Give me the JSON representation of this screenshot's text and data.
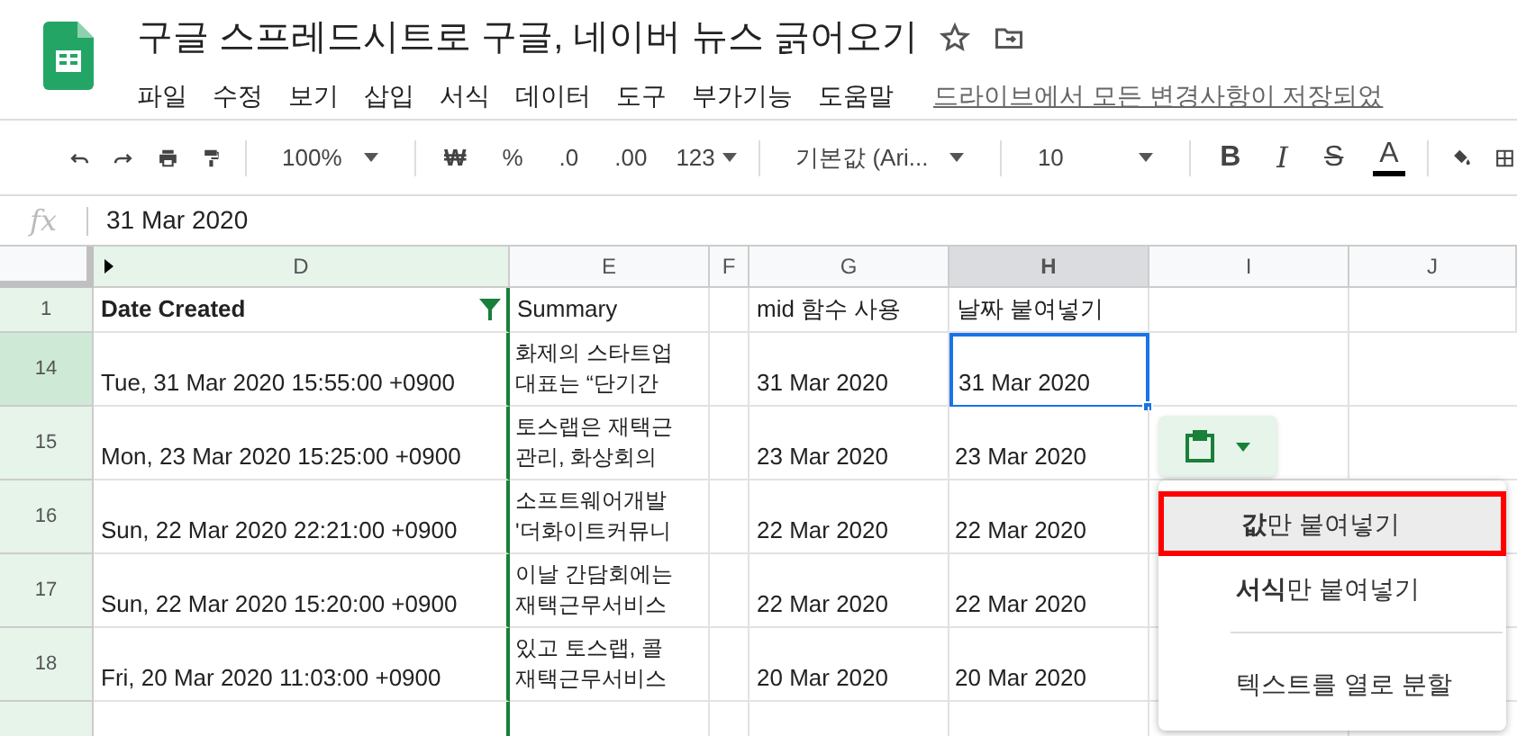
{
  "title": "구글 스프레드시트로 구글, 네이버 뉴스 긁어오기",
  "menu": [
    "파일",
    "수정",
    "보기",
    "삽입",
    "서식",
    "데이터",
    "도구",
    "부가기능",
    "도움말"
  ],
  "save_status": "드라이브에서 모든 변경사항이 저장되었",
  "toolbar": {
    "zoom": "100%",
    "currency": "₩",
    "percent": "%",
    "decrease_decimal": ".0",
    "increase_decimal": ".00",
    "format": "123",
    "font": "기본값 (Ari...",
    "font_size": "10",
    "bold": "B",
    "italic": "I",
    "strike": "S",
    "text_color": "A"
  },
  "formula_bar": {
    "fx": "fx",
    "value": "31 Mar 2020"
  },
  "columns": [
    {
      "label": "D",
      "selected": false,
      "filtered": true
    },
    {
      "label": "E",
      "selected": false,
      "filtered": false
    },
    {
      "label": "F",
      "selected": false,
      "filtered": false
    },
    {
      "label": "G",
      "selected": false,
      "filtered": false
    },
    {
      "label": "H",
      "selected": true,
      "filtered": false
    },
    {
      "label": "I",
      "selected": false,
      "filtered": false
    },
    {
      "label": "J",
      "selected": false,
      "filtered": false
    }
  ],
  "header_row": {
    "number": "1",
    "cells": [
      "Date Created",
      "Summary",
      "",
      "mid 함수 사용",
      "날짜 붙여넣기",
      "",
      ""
    ]
  },
  "rows": [
    {
      "number": "14",
      "selected": true,
      "date": "Tue, 31 Mar 2020 15:55:00 +0900",
      "summary": [
        "화제의 스타트업",
        "대표는 “단기간"
      ],
      "mid": "31 Mar 2020",
      "pasted": "31 Mar 2020"
    },
    {
      "number": "15",
      "selected": false,
      "date": "Mon, 23 Mar 2020 15:25:00 +0900",
      "summary": [
        "토스랩은 재택근",
        "관리, 화상회의"
      ],
      "mid": "23 Mar 2020",
      "pasted": "23 Mar 2020"
    },
    {
      "number": "16",
      "selected": false,
      "date": "Sun, 22 Mar 2020 22:21:00 +0900",
      "summary": [
        "소프트웨어개발",
        "'더화이트커뮤니"
      ],
      "mid": "22 Mar 2020",
      "pasted": "22 Mar 2020"
    },
    {
      "number": "17",
      "selected": false,
      "date": "Sun, 22 Mar 2020 15:20:00 +0900",
      "summary": [
        "이날 간담회에는",
        "재택근무서비스"
      ],
      "mid": "22 Mar 2020",
      "pasted": "22 Mar 2020"
    },
    {
      "number": "18",
      "selected": false,
      "date": "Fri, 20 Mar 2020 11:03:00 +0900",
      "summary": [
        "있고 토스랩, 콜",
        "재택근무서비스"
      ],
      "mid": "20 Mar 2020",
      "pasted": "20 Mar 2020"
    }
  ],
  "paste_menu": [
    {
      "kind": "item",
      "label": "**값**만 붙여넣기",
      "selected": true,
      "annotated": true
    },
    {
      "kind": "item",
      "label": "**서식**만 붙여넣기",
      "selected": false,
      "annotated": false
    },
    {
      "kind": "divider"
    },
    {
      "kind": "item",
      "label": "텍스트를 열로 분할",
      "selected": false,
      "annotated": false
    }
  ]
}
